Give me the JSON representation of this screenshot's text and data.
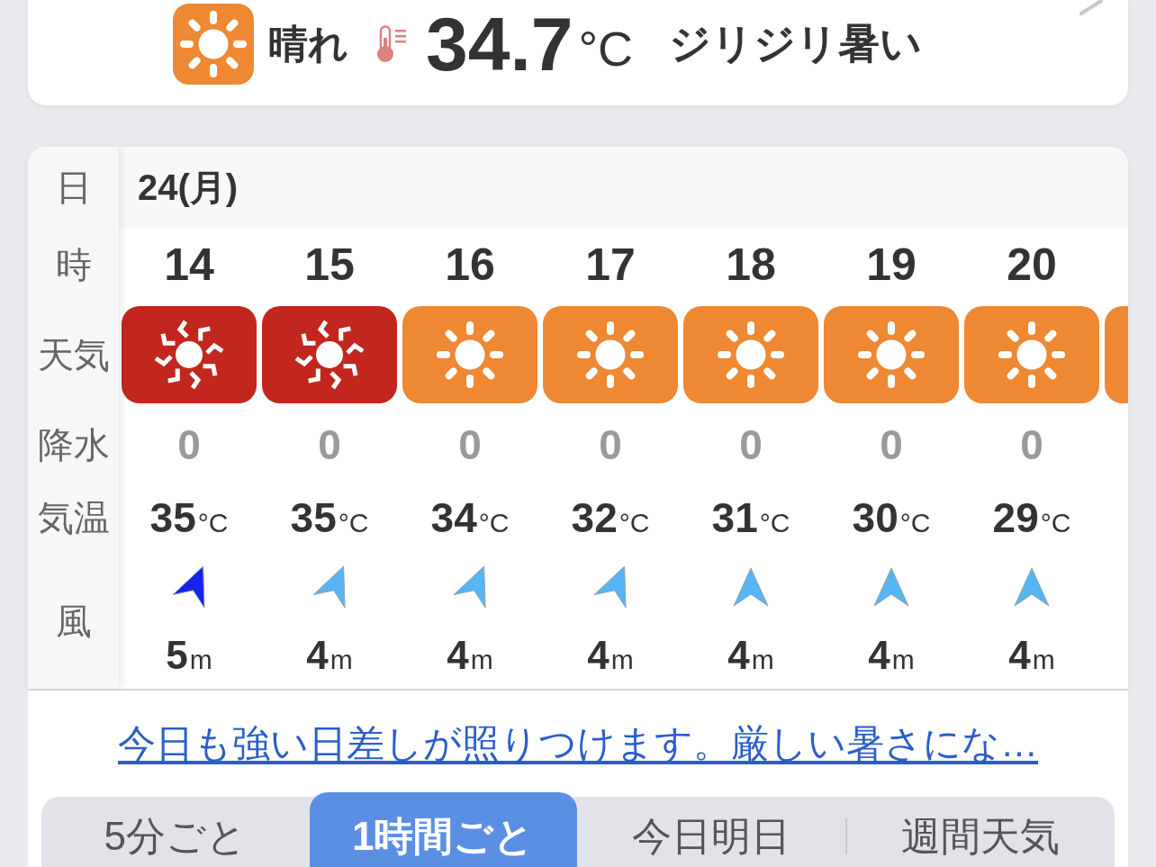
{
  "current": {
    "kind": "sunny",
    "condition": "晴れ",
    "temperature": "34.7",
    "unit": "°C",
    "comment": "ジリジリ暑い"
  },
  "forecast": {
    "row_labels": [
      "日",
      "時",
      "天気",
      "降水",
      "気温",
      "風"
    ],
    "date": "24(月)",
    "hours": [
      {
        "hour": "14",
        "kind": "extreme_heat",
        "precipitation": "0",
        "temperature": "35",
        "temperature_unit": "°C",
        "wind": {
          "kind": "SSW",
          "color": "#1424ee",
          "speed": "5",
          "unit": "m"
        }
      },
      {
        "hour": "15",
        "kind": "extreme_heat",
        "precipitation": "0",
        "temperature": "35",
        "temperature_unit": "°C",
        "wind": {
          "kind": "SSW",
          "color": "#55b5f5",
          "speed": "4",
          "unit": "m"
        }
      },
      {
        "hour": "16",
        "kind": "sunny",
        "precipitation": "0",
        "temperature": "34",
        "temperature_unit": "°C",
        "wind": {
          "kind": "SSW",
          "color": "#55b5f5",
          "speed": "4",
          "unit": "m"
        }
      },
      {
        "hour": "17",
        "kind": "sunny",
        "precipitation": "0",
        "temperature": "32",
        "temperature_unit": "°C",
        "wind": {
          "kind": "SSW",
          "color": "#55b5f5",
          "speed": "4",
          "unit": "m"
        }
      },
      {
        "hour": "18",
        "kind": "sunny",
        "precipitation": "0",
        "temperature": "31",
        "temperature_unit": "°C",
        "wind": {
          "kind": "S",
          "color": "#55b5f5",
          "speed": "4",
          "unit": "m"
        }
      },
      {
        "hour": "19",
        "kind": "sunny",
        "precipitation": "0",
        "temperature": "30",
        "temperature_unit": "°C",
        "wind": {
          "kind": "S",
          "color": "#55b5f5",
          "speed": "4",
          "unit": "m"
        }
      },
      {
        "hour": "20",
        "kind": "sunny",
        "precipitation": "0",
        "temperature": "29",
        "temperature_unit": "°C",
        "wind": {
          "kind": "S",
          "color": "#55b5f5",
          "speed": "4",
          "unit": "m"
        }
      },
      {
        "kind": "sunny"
      }
    ]
  },
  "summary_link": "今日も強い日差しが照りつけます。厳しい暑さにな…",
  "tabs": [
    {
      "label": "5分ごと",
      "selected": false
    },
    {
      "label": "1時間ごと",
      "selected": true
    },
    {
      "label": "今日明日",
      "selected": false
    },
    {
      "label": "週間天気",
      "selected": false
    }
  ]
}
